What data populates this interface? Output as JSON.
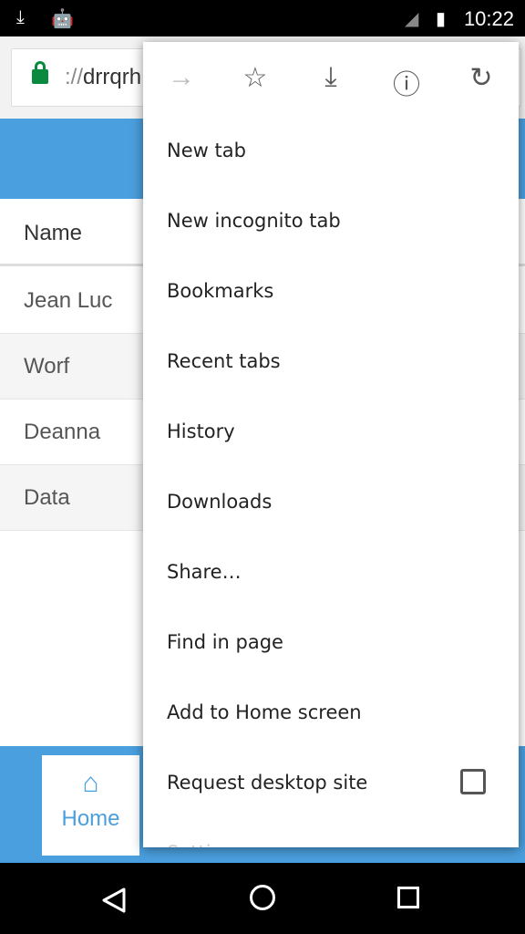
{
  "status": {
    "time": "10:22"
  },
  "browser": {
    "url_scheme": "://",
    "url_host": "drrqrh"
  },
  "table": {
    "header": "Name",
    "rows": [
      "Jean Luc",
      "Worf",
      "Deanna",
      "Data"
    ]
  },
  "bottom_nav": {
    "home_label": "Home"
  },
  "menu": {
    "icons": [
      "forward-icon",
      "star-icon",
      "download-icon",
      "info-icon",
      "reload-icon"
    ],
    "items": [
      "New tab",
      "New incognito tab",
      "Bookmarks",
      "Recent tabs",
      "History",
      "Downloads",
      "Share…",
      "Find in page",
      "Add to Home screen",
      "Request desktop site",
      "Settings"
    ],
    "request_desktop_checked": false
  },
  "colors": {
    "accent": "#4a9fde",
    "lock": "#0a8a3e"
  }
}
